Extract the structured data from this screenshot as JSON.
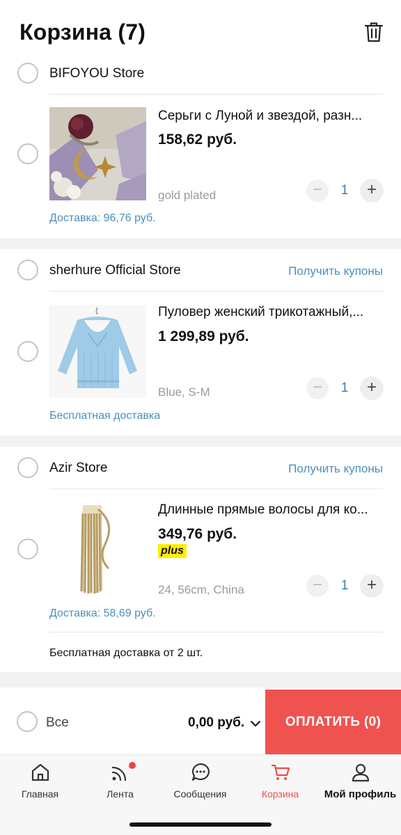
{
  "header": {
    "title": "Корзина (7)",
    "trash_icon": "trash-icon"
  },
  "stores": [
    {
      "name": "BIFOYOU Store",
      "coupons": "",
      "item": {
        "title": "Серьги с Луной и звездой, разн...",
        "price": "158,62 руб.",
        "variant": "gold plated",
        "qty": "1"
      },
      "shipping": "Доставка: 96,76 руб."
    },
    {
      "name": "sherhure Official Store",
      "coupons": "Получить купоны",
      "item": {
        "title": "Пуловер женский трикотажный,...",
        "price": "1 299,89 руб.",
        "variant": "Blue, S-M",
        "qty": "1"
      },
      "shipping": "Бесплатная доставка"
    },
    {
      "name": "Azir Store",
      "coupons": "Получить купоны",
      "item": {
        "title": "Длинные прямые волосы для ко...",
        "price": "349,76 руб.",
        "badge": "plus",
        "size_tag": "24",
        "variant": "24, 56cm, China",
        "qty": "1"
      },
      "shipping": "Доставка: 58,69 руб.",
      "note": "Бесплатная доставка от 2 шт."
    }
  ],
  "bottom": {
    "all_label": "Все",
    "total": "0,00 руб.",
    "pay_label": "ОПЛАТИТЬ (0)"
  },
  "tabs": [
    {
      "label": "Главная",
      "icon": "home-icon"
    },
    {
      "label": "Лента",
      "icon": "feed-icon"
    },
    {
      "label": "Сообщения",
      "icon": "messages-icon"
    },
    {
      "label": "Корзина",
      "icon": "cart-icon",
      "active": true
    },
    {
      "label": "Мой профиль",
      "icon": "profile-icon"
    }
  ],
  "colors": {
    "accent": "#ef5350",
    "link": "#4a90b8",
    "badge": "#ffee00"
  }
}
